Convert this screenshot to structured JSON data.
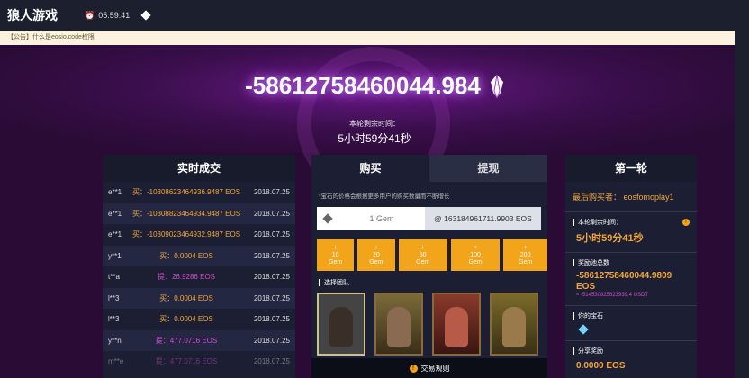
{
  "topbar": {
    "brand": "狼人游戏",
    "time": "05:59:41"
  },
  "notice": {
    "text": "【公告】什么是eosio.code权限"
  },
  "hero": {
    "amount": "-58612758460044.984",
    "remain_label": "本轮剩余时间：",
    "remain_time": "5小时59分41秒"
  },
  "trades": {
    "title": "实时成交",
    "rows": [
      {
        "user": "e**1",
        "action": "买：-10308623464936.9487 EOS",
        "kind": "buy",
        "date": "2018.07.25"
      },
      {
        "user": "e**1",
        "action": "买：-10308823464934.9487 EOS",
        "kind": "buy",
        "date": "2018.07.25"
      },
      {
        "user": "e**1",
        "action": "买：-10309023464932.9487 EOS",
        "kind": "buy",
        "date": "2018.07.25"
      },
      {
        "user": "y**1",
        "action": "买：0.0004 EOS",
        "kind": "buy",
        "date": "2018.07.25"
      },
      {
        "user": "t**a",
        "action": "提：26.9286 EOS",
        "kind": "sell",
        "date": "2018.07.25"
      },
      {
        "user": "l**3",
        "action": "买：0.0004 EOS",
        "kind": "buy",
        "date": "2018.07.25"
      },
      {
        "user": "l**3",
        "action": "买：0.0004 EOS",
        "kind": "buy",
        "date": "2018.07.25"
      },
      {
        "user": "y**n",
        "action": "提：477.0716 EOS",
        "kind": "sell",
        "date": "2018.07.25"
      },
      {
        "user": "m**e",
        "action": "提：477.0716 EOS",
        "kind": "sell",
        "date": "2018.07.25"
      }
    ]
  },
  "buy": {
    "tab_buy": "购买",
    "tab_withdraw": "提现",
    "note": "*宝石的价格会根据更多用户的购买数量而不断增长",
    "qty_placeholder": "1 Gem",
    "price": "@ 163184961711.9903 EOS",
    "qty_buttons": [
      {
        "plus": "+",
        "num": "10",
        "unit": "Gem"
      },
      {
        "plus": "+",
        "num": "20",
        "unit": "Gem"
      },
      {
        "plus": "+",
        "num": "50",
        "unit": "Gem"
      },
      {
        "plus": "+",
        "num": "100",
        "unit": "Gem"
      },
      {
        "plus": "+",
        "num": "200",
        "unit": "Gem"
      }
    ],
    "team_label": "选择团队",
    "rules": "交易规则"
  },
  "round": {
    "title": "第一轮",
    "last_buyer": "最后购买者：  eosfomoplay1",
    "remain_label": "本轮剩余时间：",
    "remain_time": "5小时59分41秒",
    "pool_label": "奖励池总数",
    "pool_eos": "-58612758460044.9809 EOS",
    "pool_usdt": "≈ -514530825823939.4 USDT",
    "gems_label": "你的宝石",
    "share_label": "分享奖励",
    "share_value": "0.0000 EOS"
  },
  "colors": {
    "accent": "#f2a41b",
    "sell": "#d04fd0",
    "panel": "#1c1f33"
  }
}
